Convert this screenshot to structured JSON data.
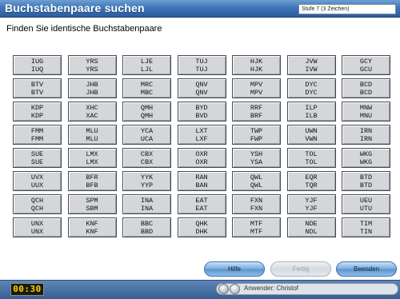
{
  "window": {
    "title": "Buchstabenpaare suchen",
    "level": "Stufe 7 (3 Zeichen)"
  },
  "instruction": "Finden Sie identische Buchstabenpaare",
  "grid": {
    "rows": [
      [
        [
          "IUG",
          "IUQ"
        ],
        [
          "YRS",
          "YRS"
        ],
        [
          "LJE",
          "LJL"
        ],
        [
          "TUJ",
          "TUJ"
        ],
        [
          "HJK",
          "HJK"
        ],
        [
          "JVW",
          "IVW"
        ],
        [
          "GCY",
          "GCU"
        ]
      ],
      [
        [
          "BTV",
          "BTV"
        ],
        [
          "JHB",
          "JHB"
        ],
        [
          "MRC",
          "MBC"
        ],
        [
          "QNV",
          "QNV"
        ],
        [
          "MPV",
          "MPV"
        ],
        [
          "DYC",
          "DYC"
        ],
        [
          "BCD",
          "BCD"
        ]
      ],
      [
        [
          "KDP",
          "KDP"
        ],
        [
          "XHC",
          "XAC"
        ],
        [
          "QMH",
          "QMH"
        ],
        [
          "BYD",
          "BVD"
        ],
        [
          "RRF",
          "BRF"
        ],
        [
          "ILP",
          "ILB"
        ],
        [
          "MNW",
          "MNU"
        ]
      ],
      [
        [
          "FMM",
          "FMM"
        ],
        [
          "MLU",
          "MLU"
        ],
        [
          "YCA",
          "UCA"
        ],
        [
          "LXT",
          "LXF"
        ],
        [
          "TWP",
          "FWP"
        ],
        [
          "UWN",
          "VWN"
        ],
        [
          "IRN",
          "IRN"
        ]
      ],
      [
        [
          "SUE",
          "SUE"
        ],
        [
          "LMX",
          "LMX"
        ],
        [
          "CBX",
          "CBX"
        ],
        [
          "OXR",
          "OXR"
        ],
        [
          "YSH",
          "YSA"
        ],
        [
          "TOL",
          "TOL"
        ],
        [
          "WKG",
          "WKG"
        ]
      ],
      [
        [
          "UVX",
          "UUX"
        ],
        [
          "BFR",
          "BFB"
        ],
        [
          "YYK",
          "YYP"
        ],
        [
          "RAN",
          "BAN"
        ],
        [
          "QWL",
          "QWL"
        ],
        [
          "EQR",
          "TQR"
        ],
        [
          "BTD",
          "BTD"
        ]
      ],
      [
        [
          "QCH",
          "QCH"
        ],
        [
          "SPM",
          "SBM"
        ],
        [
          "INA",
          "INA"
        ],
        [
          "EAT",
          "EAT"
        ],
        [
          "FXN",
          "FXN"
        ],
        [
          "YJF",
          "YJF"
        ],
        [
          "UEU",
          "UTU"
        ]
      ],
      [
        [
          "UNX",
          "UNX"
        ],
        [
          "KNF",
          "KNF"
        ],
        [
          "BBC",
          "BBD"
        ],
        [
          "QHK",
          "DHK"
        ],
        [
          "MTF",
          "MTF"
        ],
        [
          "NDE",
          "NDL"
        ],
        [
          "TIM",
          "TIN"
        ]
      ]
    ]
  },
  "buttons": {
    "help": "Hilfe",
    "done": "Fertig",
    "quit": "Beenden"
  },
  "status": {
    "timer": "00:30",
    "user": "Anwender: Christof"
  },
  "colors": {
    "titlebar": "#3f76b8",
    "timer_digits": "#ffd400",
    "button": "#7fb1e1"
  }
}
